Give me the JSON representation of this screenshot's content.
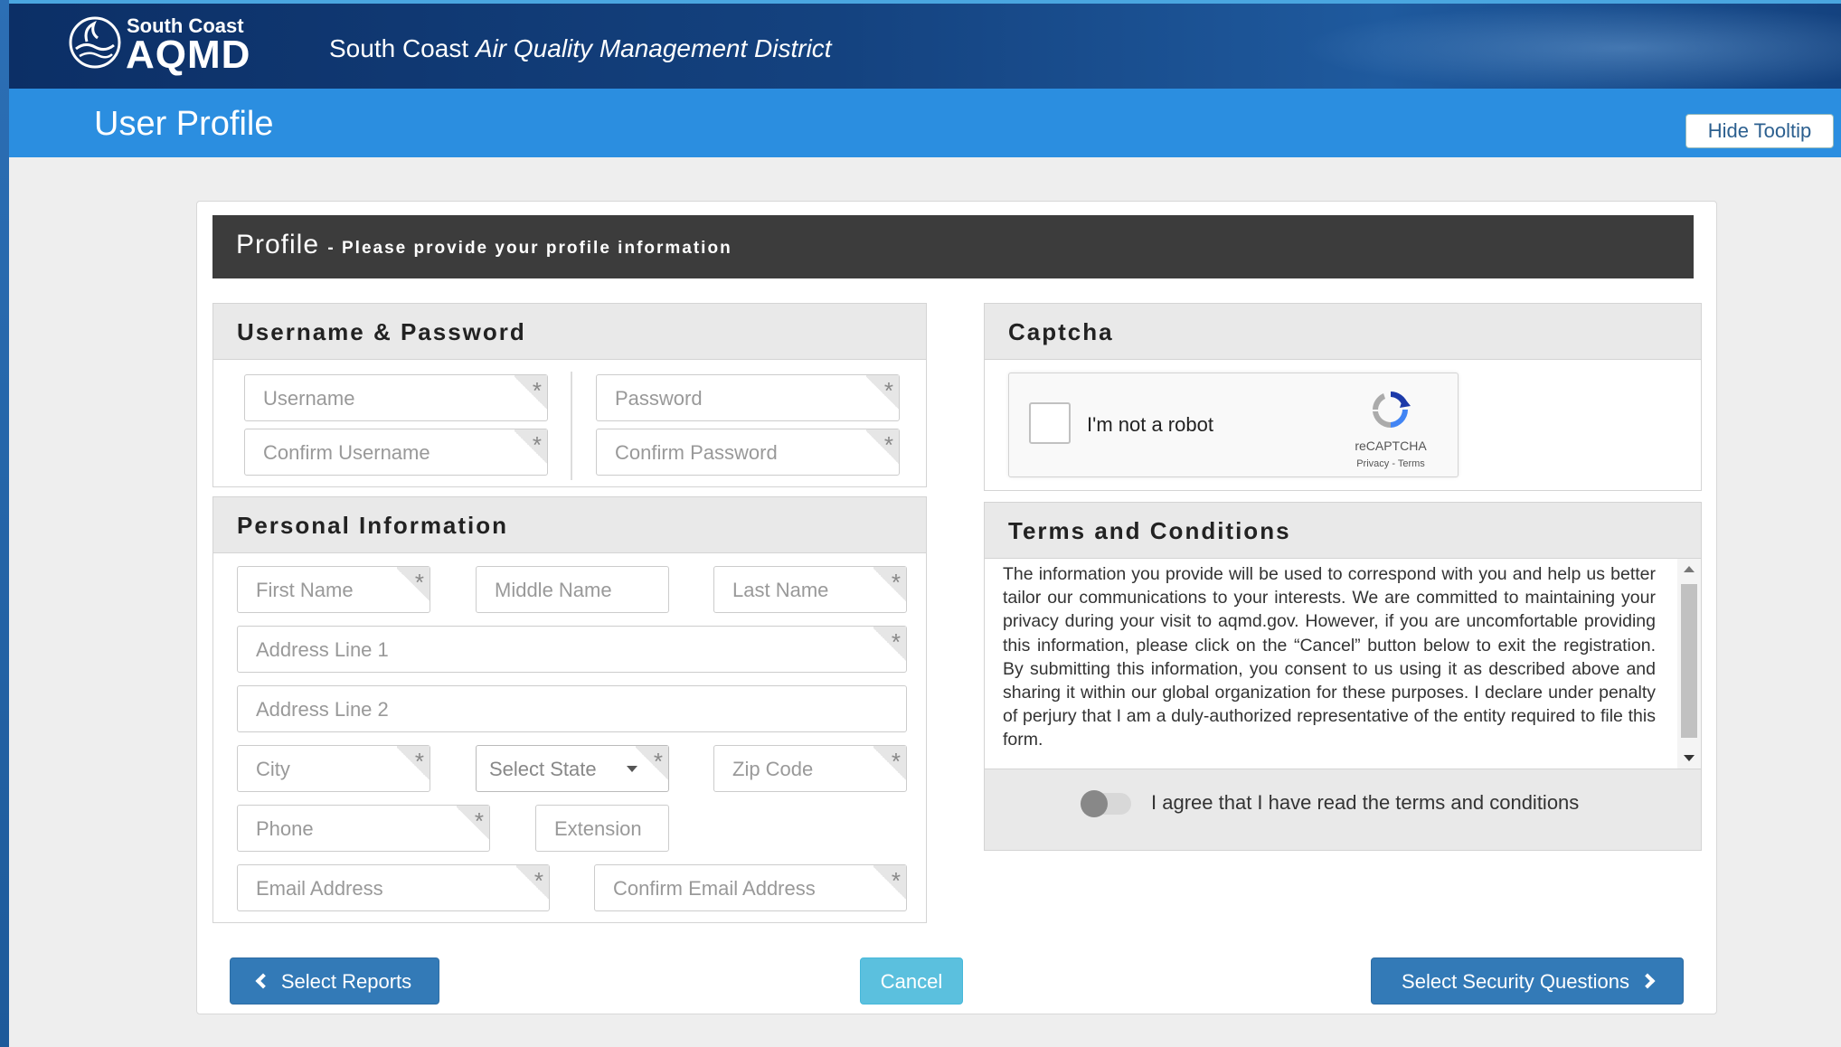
{
  "header": {
    "logo_small": "South Coast",
    "logo_big": "AQMD",
    "district_plain": "South Coast",
    "district_italic": "Air Quality Management District"
  },
  "title_bar": {
    "title": "User Profile",
    "hide_tooltip": "Hide Tooltip"
  },
  "profile": {
    "title": "Profile",
    "subtitle": "- Please provide your profile information"
  },
  "username_password": {
    "heading": "Username & Password",
    "username": "Username",
    "confirm_username": "Confirm Username",
    "password": "Password",
    "confirm_password": "Confirm Password"
  },
  "personal_info": {
    "heading": "Personal Information",
    "first_name": "First Name",
    "middle_name": "Middle Name",
    "last_name": "Last Name",
    "address1": "Address Line 1",
    "address2": "Address Line 2",
    "city": "City",
    "state": "Select State",
    "zip": "Zip Code",
    "phone": "Phone",
    "extension": "Extension",
    "email": "Email Address",
    "confirm_email": "Confirm Email Address"
  },
  "captcha": {
    "heading": "Captcha",
    "label": "I'm not a robot",
    "brand": "reCAPTCHA",
    "links": "Privacy - Terms"
  },
  "terms": {
    "heading": "Terms and Conditions",
    "text": "The information you provide will be used to correspond with you and help us better tailor our communications to your interests. We are committed to maintaining your privacy during your visit to aqmd.gov. However, if you are uncomfortable providing this information, please click on the “Cancel” button below to exit the registration. By submitting this information, you consent to us using it as described above and sharing it within our global organization for these purposes. I declare under penalty of perjury that I am a duly-authorized representative of the entity required to file this form.",
    "agree": "I agree that I have read the terms and conditions"
  },
  "buttons": {
    "select_reports": "Select Reports",
    "cancel": "Cancel",
    "select_security": "Select Security Questions"
  },
  "colors": {
    "title_bar": "#2b8ee0",
    "profile_bar": "#3c3c3c",
    "primary_button": "#337ab7",
    "cancel_button": "#5bc0de"
  },
  "icons": [
    "aqmd-logo-icon",
    "recaptcha-icon",
    "chevron-left-icon",
    "chevron-right-icon",
    "caret-down-icon",
    "required-star-icon"
  ]
}
